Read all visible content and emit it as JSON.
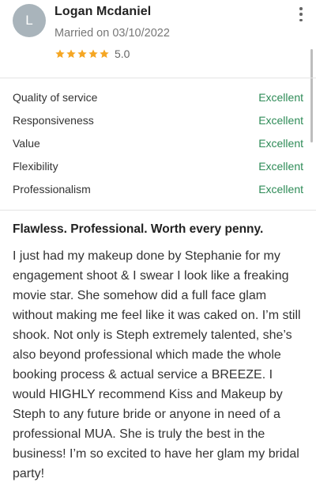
{
  "reviewer": {
    "avatar_initial": "L",
    "name": "Logan Mcdaniel",
    "married_label": "Married on 03/10/2022",
    "rating_value": "5.0",
    "stars": 5
  },
  "colors": {
    "star": "#f5a623",
    "excellent": "#2e8b57",
    "avatar": "#a9b4bb"
  },
  "ratings": [
    {
      "label": "Quality of service",
      "grade": "Excellent"
    },
    {
      "label": "Responsiveness",
      "grade": "Excellent"
    },
    {
      "label": "Value",
      "grade": "Excellent"
    },
    {
      "label": "Flexibility",
      "grade": "Excellent"
    },
    {
      "label": "Professionalism",
      "grade": "Excellent"
    }
  ],
  "review": {
    "title": "Flawless. Professional. Worth every penny.",
    "body": "I just had my makeup done by Stephanie for my engagement shoot & I swear I look like a freaking movie star. She somehow did a full face glam without making me feel like it was caked on. I’m still shook. Not only is Steph extremely talented, she’s also beyond professional which made the whole booking process & actual service a BREEZE. I would HIGHLY recommend Kiss and Makeup by Steph to any future bride or anyone in need of a professional MUA. She is truly the best in the business! I’m so excited to have her glam my bridal party!"
  },
  "icons": {
    "menu": "more-vertical-icon",
    "star": "star-icon"
  }
}
